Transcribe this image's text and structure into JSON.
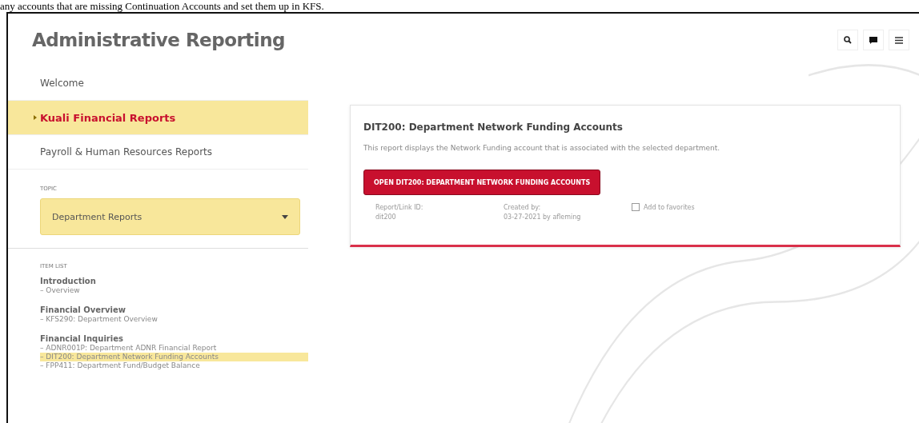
{
  "intro_text": "any accounts that are missing Continuation Accounts and set them up in KFS.",
  "header": {
    "title": "Administrative Reporting"
  },
  "nav": [
    {
      "label": "Welcome",
      "selected": false
    },
    {
      "label": "Kuali Financial Reports",
      "selected": true
    },
    {
      "label": "Payroll & Human Resources Reports",
      "selected": false
    }
  ],
  "topic": {
    "label": "TOPIC",
    "value": "Department Reports"
  },
  "item_list": {
    "label": "ITEM LIST",
    "groups": [
      {
        "title": "Introduction",
        "children": [
          {
            "label": "– Overview",
            "selected": false
          }
        ]
      },
      {
        "title": "Financial Overview",
        "children": [
          {
            "label": "– KFS290: Department Overview",
            "selected": false
          }
        ]
      },
      {
        "title": "Financial Inquiries",
        "children": [
          {
            "label": "– ADNR001P: Department ADNR Financial Report",
            "selected": false
          },
          {
            "label": "– DIT200: Department Network Funding Accounts",
            "selected": true
          },
          {
            "label": "– FPP411: Department Fund/Budget Balance",
            "selected": false
          }
        ]
      }
    ]
  },
  "report": {
    "title": "DIT200: Department Network Funding Accounts",
    "description": "This report displays the Network Funding account that is associated with the selected department.",
    "button": "OPEN DIT200: DEPARTMENT NETWORK FUNDING ACCOUNTS",
    "id_label": "Report/Link ID:",
    "id_value": "dit200",
    "created_label": "Created by:",
    "created_value": "03-27-2021 by afleming",
    "favorite": {
      "label": "Add to favorites",
      "checked": false
    }
  }
}
